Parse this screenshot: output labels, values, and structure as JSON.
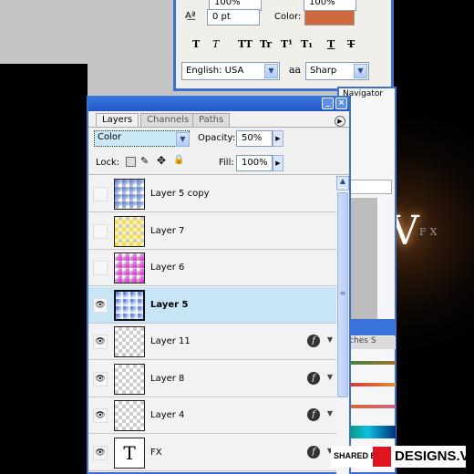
{
  "character": {
    "leading_value": "100%",
    "tracking_value": "100%",
    "baseline_shift": "0 pt",
    "color_label": "Color:",
    "color": "#cf6a40",
    "format_buttons": [
      "T",
      "T",
      "TT",
      "Tr",
      "T¹",
      "T₁",
      "T",
      "T"
    ],
    "language": "English: USA",
    "aa_icon": "aa",
    "antialias": "Sharp"
  },
  "navigator": {
    "tab": "Navigator",
    "zoom_partial": "%"
  },
  "swatches": {
    "tab_partial": "atches",
    "tab2_partial": "S"
  },
  "layers": {
    "tabs": [
      "Layers",
      "Channels",
      "Paths"
    ],
    "blend_mode": "Color",
    "opacity_label": "Opacity:",
    "opacity": "50%",
    "lock_label": "Lock:",
    "fill_label": "Fill:",
    "fill": "100%",
    "items": [
      {
        "name": "Layer 5 copy",
        "visible": false,
        "thumb": "blue-gradient",
        "fx": false
      },
      {
        "name": "Layer 7",
        "visible": false,
        "thumb": "yellow-gradient",
        "fx": false
      },
      {
        "name": "Layer 6",
        "visible": false,
        "thumb": "magenta-gradient",
        "fx": false
      },
      {
        "name": "Layer 5",
        "visible": true,
        "thumb": "blue-gradient",
        "fx": false,
        "selected": true
      },
      {
        "name": "Layer 11",
        "visible": true,
        "thumb": "transparent",
        "fx": true
      },
      {
        "name": "Layer 8",
        "visible": true,
        "thumb": "transparent",
        "fx": true
      },
      {
        "name": "Layer 4",
        "visible": true,
        "thumb": "transparent",
        "fx": true
      },
      {
        "name": "FX",
        "visible": true,
        "thumb": "text",
        "fx": true
      }
    ]
  },
  "canvas": {
    "text_big": "V",
    "text_small": "FX"
  },
  "watermark": {
    "shared_by": "SHARED BY",
    "brand": "DESIGNS.VN"
  }
}
